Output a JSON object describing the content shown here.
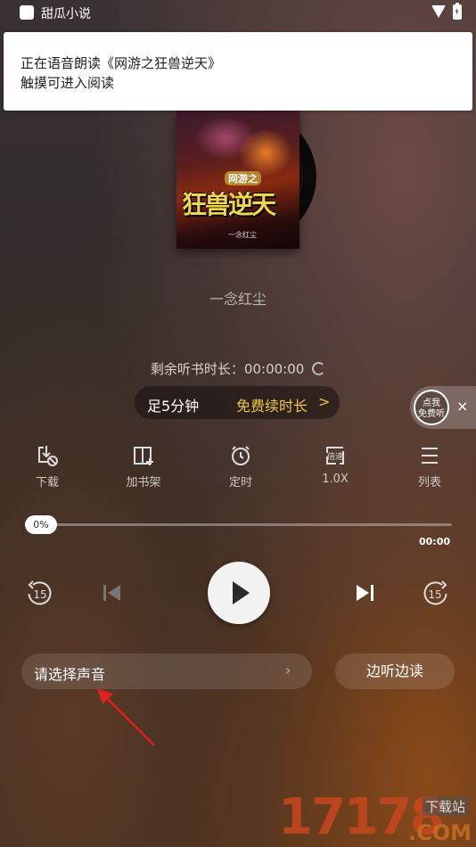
{
  "status_bar": {
    "app_name": "甜瓜小说"
  },
  "notification": {
    "line1": "正在语音朗读《网游之狂兽逆天》",
    "line2": "触摸可进入阅读"
  },
  "book": {
    "series": "网游之",
    "title": "狂兽逆天",
    "cover_author": "一念红尘"
  },
  "author": "一念红尘",
  "remaining": {
    "label": "剩余听书时长：",
    "time": "00:00:00"
  },
  "listen_pill": {
    "left": "足5分钟",
    "right": "免费续时长",
    "chevron": ">"
  },
  "free_badge": {
    "line1": "点我",
    "line2": "免费听",
    "close": "×"
  },
  "functions": [
    {
      "label": "下载",
      "icon": "download-icon"
    },
    {
      "label": "加书架",
      "icon": "add-bookshelf-icon"
    },
    {
      "label": "定时",
      "icon": "alarm-clock-icon"
    },
    {
      "label": "1.0X",
      "icon": "speed-icon",
      "icon_text": "倍速"
    },
    {
      "label": "列表",
      "icon": "list-icon"
    }
  ],
  "progress": {
    "thumb_label": "0%",
    "value_fraction": 0,
    "time": "00:00"
  },
  "controls": {
    "rewind_seconds": "15",
    "forward_seconds": "15"
  },
  "voice_select": {
    "label": "请选择声音",
    "chevron": "›"
  },
  "listen_read": {
    "label": "边听边读"
  },
  "watermark": {
    "number": "17178",
    "tag": "下载站",
    "domain": ".COM"
  },
  "colors": {
    "accent_gold": "#f4c53e",
    "arrow_red": "#e02020"
  }
}
